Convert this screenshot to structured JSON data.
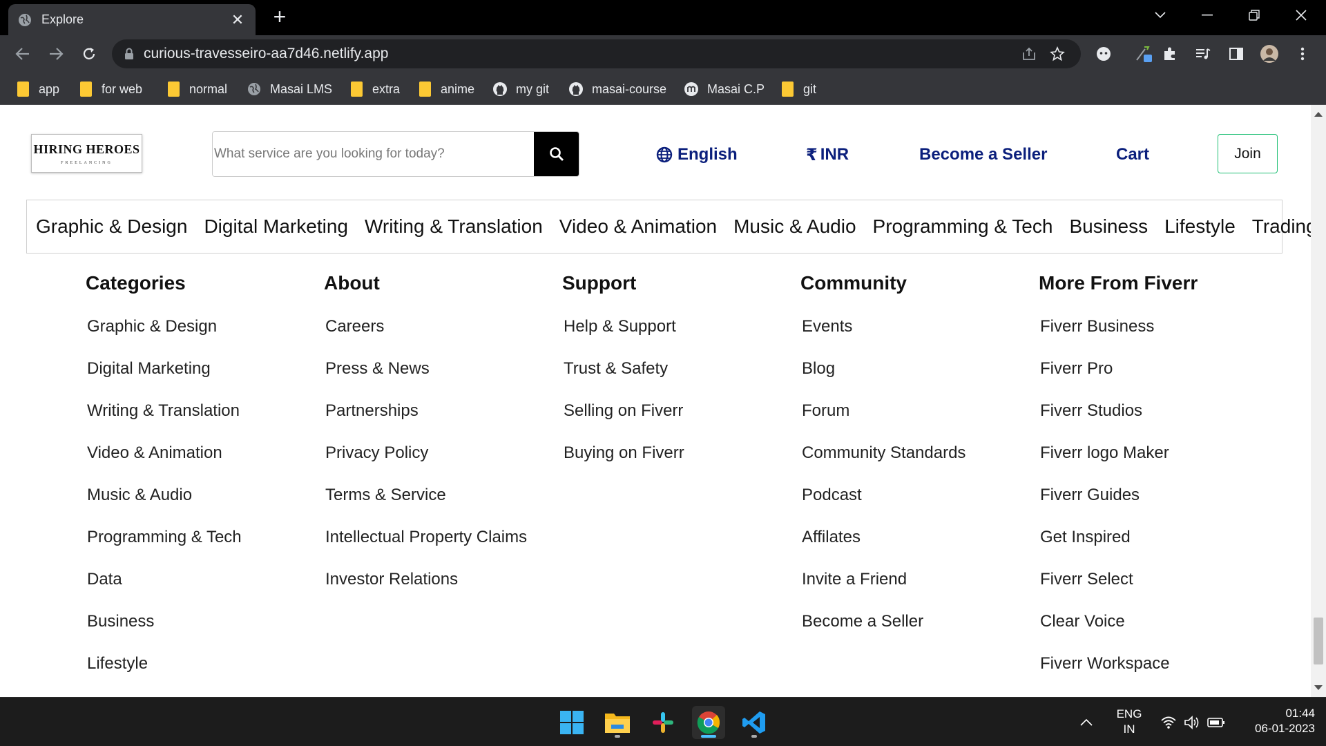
{
  "browser": {
    "tab_title": "Explore",
    "url": "curious-travesseiro-aa7d46.netlify.app",
    "bookmarks": [
      {
        "label": "app",
        "icon": "folder-icon"
      },
      {
        "label": "for web",
        "icon": "folder-icon"
      },
      {
        "label": "normal",
        "icon": "folder-icon"
      },
      {
        "label": "Masai LMS",
        "icon": "globe-icon"
      },
      {
        "label": "extra",
        "icon": "folder-icon"
      },
      {
        "label": "anime",
        "icon": "folder-icon"
      },
      {
        "label": "my git",
        "icon": "github-icon"
      },
      {
        "label": "masai-course",
        "icon": "github-icon"
      },
      {
        "label": "Masai C.P",
        "icon": "masai-icon"
      },
      {
        "label": "git",
        "icon": "folder-icon"
      }
    ]
  },
  "header": {
    "logo_main": "HIRING HEROES",
    "logo_sub": "FREELANCING",
    "search_placeholder": "What service are you looking for today?",
    "language": "English",
    "currency_symbol": "₹",
    "currency": "INR",
    "become_seller": "Become a Seller",
    "cart": "Cart",
    "join": "Join",
    "link_color": "#0b1f7c",
    "join_border_color": "#1dbf73"
  },
  "category_nav": [
    "Graphic & Design",
    "Digital Marketing",
    "Writing & Translation",
    "Video & Animation",
    "Music & Audio",
    "Programming & Tech",
    "Business",
    "Lifestyle",
    "Trading"
  ],
  "footer": {
    "columns": [
      {
        "title": "Categories",
        "items": [
          "Graphic & Design",
          "Digital Marketing",
          "Writing & Translation",
          "Video & Animation",
          "Music & Audio",
          "Programming & Tech",
          "Data",
          "Business",
          "Lifestyle"
        ]
      },
      {
        "title": "About",
        "items": [
          "Careers",
          "Press & News",
          "Partnerships",
          "Privacy Policy",
          "Terms & Service",
          "Intellectual Property Claims",
          "Investor Relations"
        ]
      },
      {
        "title": "Support",
        "items": [
          "Help & Support",
          "Trust & Safety",
          "Selling on Fiverr",
          "Buying on Fiverr"
        ]
      },
      {
        "title": "Community",
        "items": [
          "Events",
          "Blog",
          "Forum",
          "Community Standards",
          "Podcast",
          "Affilates",
          "Invite a Friend",
          "Become a Seller"
        ]
      },
      {
        "title": "More From Fiverr",
        "items": [
          "Fiverr Business",
          "Fiverr Pro",
          "Fiverr Studios",
          "Fiverr logo Maker",
          "Fiverr Guides",
          "Get Inspired",
          "Fiverr Select",
          "Clear Voice",
          "Fiverr Workspace"
        ]
      }
    ]
  },
  "taskbar": {
    "apps": [
      "windows-start-icon",
      "file-explorer-icon",
      "slack-icon",
      "chrome-icon",
      "vscode-icon"
    ],
    "lang_line1": "ENG",
    "lang_line2": "IN",
    "time": "01:44",
    "date": "06-01-2023"
  }
}
